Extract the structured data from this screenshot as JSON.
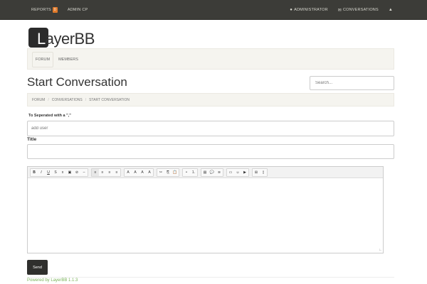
{
  "topbar": {
    "reports_label": "REPORTS",
    "reports_count": "0",
    "admin_label": "ADMIN CP",
    "user_label": "ADMINISTRATOR",
    "conversations_label": "CONVERSATIONS"
  },
  "logo": {
    "letter": "L",
    "rest": "ayerBB"
  },
  "subnav": {
    "tabs": [
      {
        "label": "FORUM"
      },
      {
        "label": "MEMBERS"
      }
    ]
  },
  "page": {
    "title": "Start Conversation"
  },
  "search": {
    "placeholder": "Search..."
  },
  "breadcrumb": {
    "items": [
      "FORUM",
      "CONVERSATIONS",
      "START CONVERSATION"
    ]
  },
  "form": {
    "to_label": "To Seperated with a \",\"",
    "to_placeholder": "add user",
    "title_label": "Title",
    "title_value": ""
  },
  "editor": {
    "tools": [
      [
        "B",
        "I",
        "U",
        "S",
        "x",
        "▣",
        "⊘",
        "–"
      ],
      [
        "≡",
        "≡",
        "≡",
        "≡"
      ],
      [
        "A",
        "A",
        "A",
        "A"
      ],
      [
        "✂",
        "⎘",
        "📋"
      ],
      [
        "•",
        "1."
      ],
      [
        "▤",
        "💬",
        "≋"
      ],
      [
        "▭",
        "☺",
        "▶"
      ],
      [
        "⊞",
        "▯"
      ]
    ]
  },
  "send_label": "Send",
  "footer": "Powered by LayerBB 1.1.3"
}
